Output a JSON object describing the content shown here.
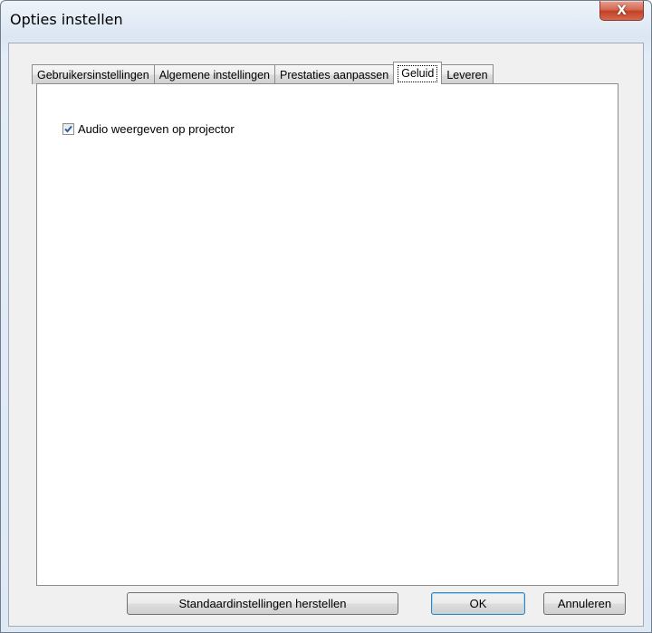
{
  "window": {
    "title": "Opties instellen",
    "close_label": "X"
  },
  "tabs": [
    {
      "label": "Gebruikersinstellingen",
      "active": false
    },
    {
      "label": "Algemene instellingen",
      "active": false
    },
    {
      "label": "Prestaties aanpassen",
      "active": false
    },
    {
      "label": "Geluid",
      "active": true
    },
    {
      "label": "Leveren",
      "active": false
    }
  ],
  "sound": {
    "audio_checkbox_label": "Audio weergeven op projector",
    "audio_checked": true
  },
  "buttons": {
    "restore_label": "Standaardinstellingen herstellen",
    "ok_label": "OK",
    "cancel_label": "Annuleren"
  },
  "colors": {
    "close_button": "#c44125",
    "check_mark": "#2b5fa8",
    "default_button_border": "#3c7fb1"
  },
  "icons": {
    "close": "close-icon",
    "check": "checkmark-icon"
  }
}
